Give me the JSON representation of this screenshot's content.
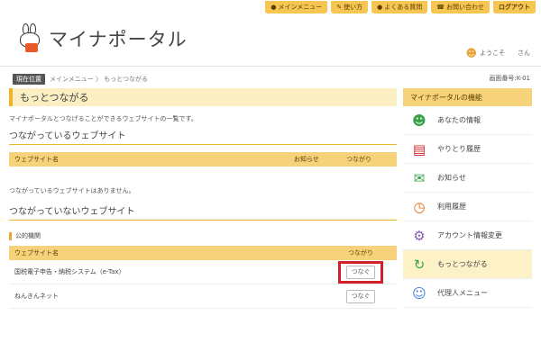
{
  "topbar": {
    "links": [
      {
        "label": "メインメニュー",
        "icon": "arrow-icon"
      },
      {
        "label": "使い方",
        "icon": "pencil-icon"
      },
      {
        "label": "よくある質問",
        "icon": "arrow-icon"
      },
      {
        "label": "お問い合わせ",
        "icon": "phone-icon"
      }
    ],
    "logout": "ログアウト"
  },
  "header": {
    "logo_text": "マイナポータル",
    "welcome": "ようこそ",
    "user_suffix": "さん"
  },
  "breadcrumb": {
    "tag": "現在位置",
    "path": "メインメニュー 〉 もっとつながる",
    "screen_no": "画面番号:K-01"
  },
  "main": {
    "title": "もっとつながる",
    "description": "マイナポータルとつなげることができるウェブサイトの一覧です。",
    "connected": {
      "title": "つながっているウェブサイト",
      "headers": [
        "ウェブサイト名",
        "お知らせ",
        "つながり"
      ],
      "empty_text": "つながっているウェブサイトはありません。"
    },
    "not_connected": {
      "title": "つながっていないウェブサイト",
      "category": "公的機関",
      "headers": [
        "ウェブサイト名",
        "つながり"
      ],
      "rows": [
        {
          "name": "国税電子申告・納税システム（e-Tax）",
          "action": "つなぐ",
          "highlighted": true
        },
        {
          "name": "ねんきんネット",
          "action": "つなぐ",
          "highlighted": false
        }
      ]
    }
  },
  "sidebar": {
    "title": "マイナポータルの機能",
    "items": [
      {
        "label": "あなたの情報",
        "icon": "people-icon",
        "color": "#3aa34a"
      },
      {
        "label": "やりとり履歴",
        "icon": "document-icon",
        "color": "#d0202a"
      },
      {
        "label": "お知らせ",
        "icon": "envelope-icon",
        "color": "#3aa34a"
      },
      {
        "label": "利用履歴",
        "icon": "clock-icon",
        "color": "#e06a1a"
      },
      {
        "label": "アカウント情報変更",
        "icon": "gear-icon",
        "color": "#8a5cb5"
      },
      {
        "label": "もっとつながる",
        "icon": "link-icon",
        "color": "#3aa34a",
        "active": true
      },
      {
        "label": "代理人メニュー",
        "icon": "people-icon",
        "color": "#3a7bd5"
      }
    ]
  }
}
